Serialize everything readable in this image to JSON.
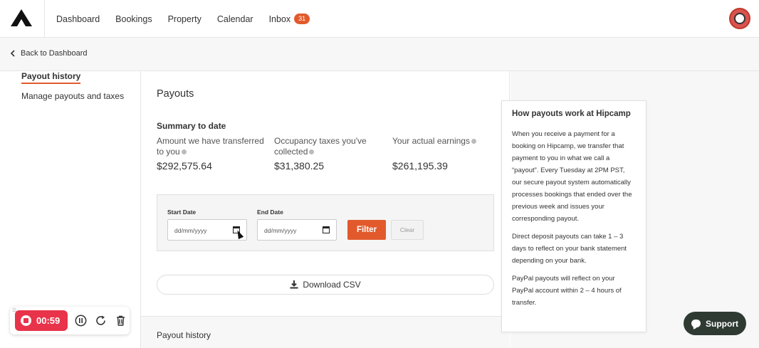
{
  "nav": {
    "links": [
      "Dashboard",
      "Bookings",
      "Property",
      "Calendar"
    ],
    "inbox_label": "Inbox",
    "inbox_count": "31"
  },
  "backbar": {
    "label": "Back to Dashboard"
  },
  "sidebar": {
    "items": [
      {
        "label": "Payout history",
        "active": true
      },
      {
        "label": "Manage payouts and taxes",
        "active": false
      }
    ]
  },
  "main": {
    "title": "Payouts",
    "summary_title": "Summary to date",
    "stats": [
      {
        "label": "Amount we have transferred to you",
        "value": "$292,575.64"
      },
      {
        "label": "Occupancy taxes you've collected",
        "value": "$31,380.25"
      },
      {
        "label": "Your actual earnings",
        "value": "$261,195.39"
      }
    ],
    "filter": {
      "start_label": "Start Date",
      "end_label": "End Date",
      "start_placeholder": "dd/mm/yyyy",
      "end_placeholder": "dd/mm/yyyy",
      "filter_button": "Filter",
      "clear_button": "Clear"
    },
    "download_label": "Download CSV",
    "history_title": "Payout history"
  },
  "info": {
    "title": "How payouts work at Hipcamp",
    "paragraphs": [
      "When you receive a payment for a booking on Hipcamp, we transfer that payment to you in what we call a “payout”. Every Tuesday at 2PM PST, our secure payout system automatically processes bookings that ended over the previous week and issues your corresponding payout.",
      "Direct deposit payouts can take 1 – 3 days to reflect on your bank statement depending on your bank.",
      "PayPal payouts will reflect on your PayPal account within 2 – 4 hours of transfer."
    ]
  },
  "support": {
    "label": "Support"
  },
  "recorder": {
    "time": "00:59"
  },
  "colors": {
    "accent": "#e25a2c",
    "support_bg": "#2f3a33",
    "record_red": "#e8334a"
  }
}
